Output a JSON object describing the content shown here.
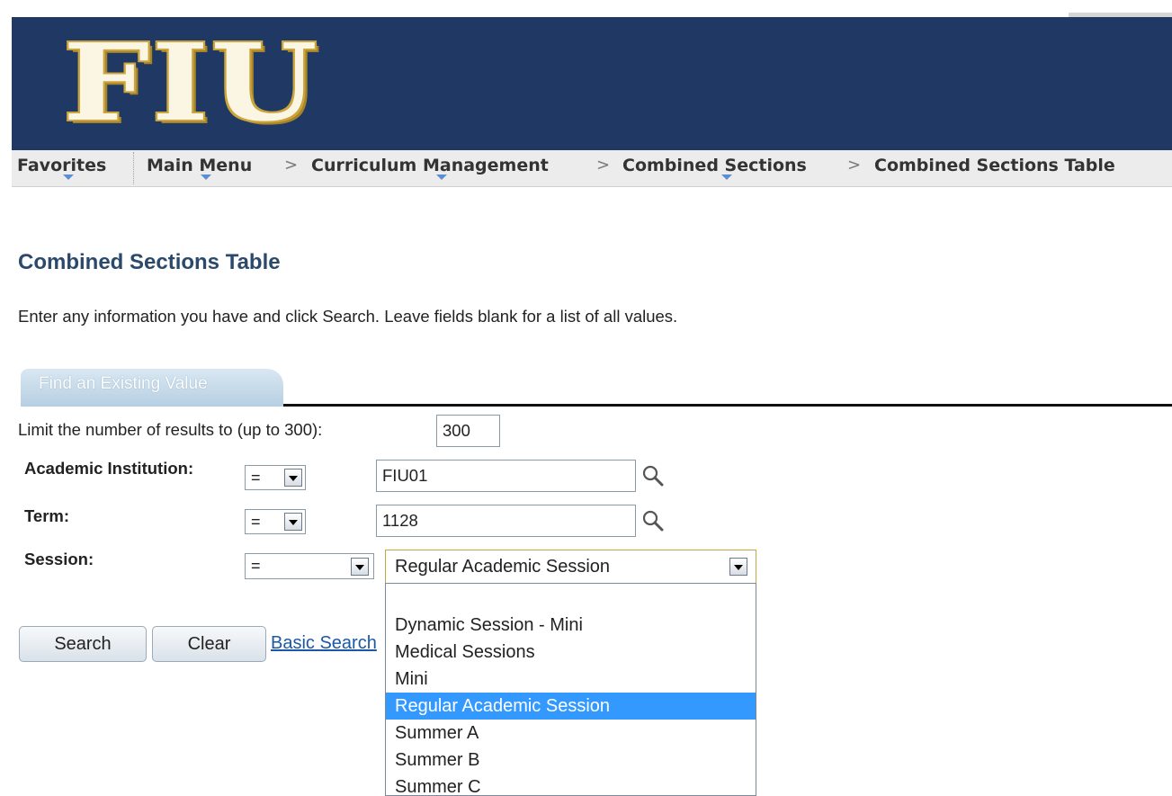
{
  "header": {
    "logo_text": "FIU"
  },
  "nav": {
    "items": [
      {
        "label": "Favorites"
      },
      {
        "label": "Main Menu"
      },
      {
        "label": "Curriculum Management"
      },
      {
        "label": "Combined Sections"
      },
      {
        "label": "Combined Sections Table"
      }
    ],
    "separator": ">"
  },
  "page": {
    "title": "Combined Sections Table",
    "instructions": "Enter any information you have and click Search. Leave fields blank for a list of all values."
  },
  "tab": {
    "label": "Find an Existing Value"
  },
  "form": {
    "limit_label": "Limit the number of results to (up to 300):",
    "limit_value": "300",
    "institution": {
      "label": "Academic Institution:",
      "operator": "=",
      "value": "FIU01"
    },
    "term": {
      "label": "Term:",
      "operator": "=",
      "value": "1128"
    },
    "session": {
      "label": "Session:",
      "operator": "=",
      "value": "Regular Academic Session",
      "options": [
        "",
        "Dynamic Session - Mini",
        "Medical Sessions",
        "Mini",
        "Regular Academic Session",
        "Summer A",
        "Summer B",
        "Summer C"
      ],
      "selected_index": 4
    }
  },
  "actions": {
    "search_label": "Search",
    "clear_label": "Clear",
    "basic_search_label": "Basic Search"
  },
  "colors": {
    "banner": "#1f3864",
    "title": "#2b4a6b",
    "link": "#1b58a8",
    "selected_option": "#3399ff"
  }
}
